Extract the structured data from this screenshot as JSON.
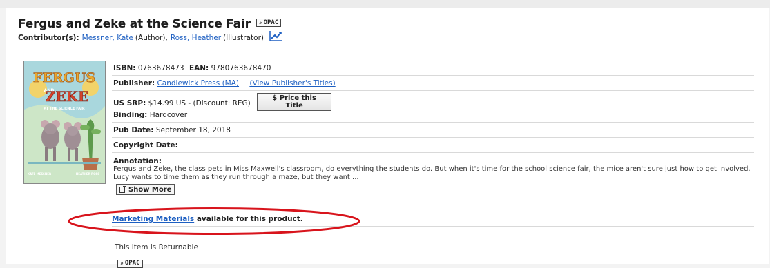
{
  "book": {
    "title": "Fergus and Zeke at the Science Fair",
    "opac_label": "OPAC",
    "contributors_label": "Contributor(s):",
    "contributors": [
      {
        "name": "Messner, Kate",
        "role": "(Author),"
      },
      {
        "name": "Ross, Heather",
        "role": "(Illustrator)"
      }
    ]
  },
  "cover": {
    "title_line1": "FERGUS",
    "title_and": "AND",
    "title_line2": "ZEKE",
    "subtitle": "AT THE SCIENCE FAIR",
    "author_strip": "KATE MESSNER",
    "illustrator_strip": "HEATHER ROSS"
  },
  "details": {
    "isbn_label": "ISBN:",
    "isbn": "0763678473",
    "ean_label": "EAN:",
    "ean": "9780763678470",
    "publisher_label": "Publisher:",
    "publisher": "Candlewick Press (MA)",
    "publisher_titles_link": "(View Publisher's Titles)",
    "srp_label": "US SRP:",
    "srp": "$14.99 US - (Discount: REG)",
    "price_button": "$ Price this Title",
    "binding_label": "Binding:",
    "binding": "Hardcover",
    "pubdate_label": "Pub Date:",
    "pubdate": "September 18, 2018",
    "copyright_label": "Copyright Date:",
    "copyright": "",
    "annotation_label": "Annotation:",
    "annotation": "Fergus and Zeke, the class pets in Miss Maxwell's classroom, do everything the students do. But when it's time for the school science fair, the mice aren't sure just how to get involved. Lucy wants to time them as they run through a maze, but they want ...",
    "show_more": "Show More"
  },
  "marketing": {
    "link": "Marketing Materials",
    "text": "available for this product."
  },
  "footer": {
    "returnable": "This item is Returnable",
    "opac_label": "OPAC"
  },
  "colors": {
    "link": "#1d5fc2",
    "highlight_oval": "#d8141c"
  }
}
